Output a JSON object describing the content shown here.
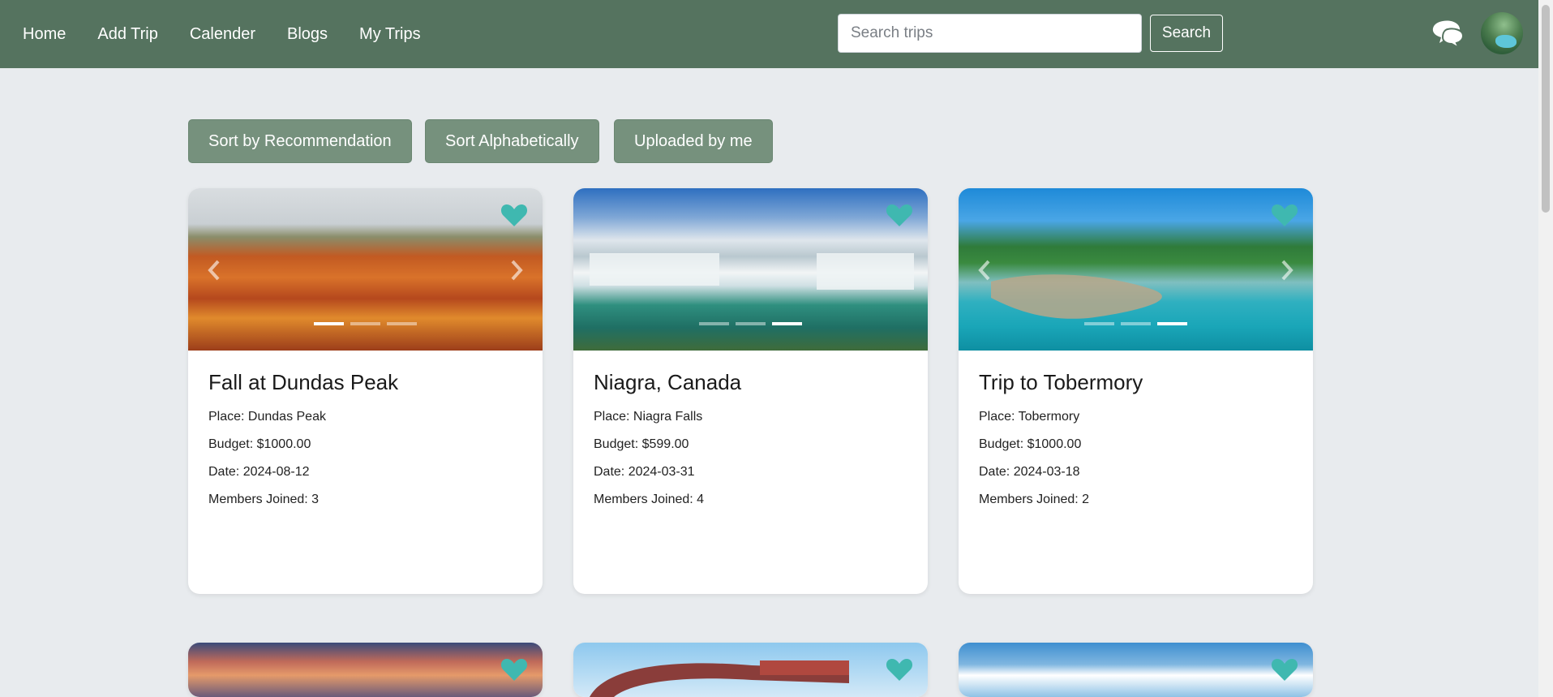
{
  "nav": {
    "links": [
      "Home",
      "Add Trip",
      "Calender",
      "Blogs",
      "My Trips"
    ],
    "search_placeholder": "Search trips",
    "search_button": "Search",
    "chat_icon": "chat-bubbles-icon",
    "avatar_icon": "user-avatar"
  },
  "sort": {
    "recommendation": "Sort by Recommendation",
    "alphabetical": "Sort Alphabetically",
    "uploaded": "Uploaded by me"
  },
  "colors": {
    "navbar": "#55735f",
    "sort_button": "#76917d",
    "heart": "#3fb8b0",
    "page_bg": "#e8ebee"
  },
  "trips": [
    {
      "title": "Fall at Dundas Peak",
      "place": "Place: Dundas Peak",
      "budget": "Budget: $1000.00",
      "date": "Date: 2024-08-12",
      "members": "Members Joined: 3",
      "active_slide": 1
    },
    {
      "title": "Niagra, Canada",
      "place": "Place: Niagra Falls",
      "budget": "Budget: $599.00",
      "date": "Date: 2024-03-31",
      "members": "Members Joined: 4",
      "active_slide": 3
    },
    {
      "title": "Trip to Tobermory",
      "place": "Place: Tobermory",
      "budget": "Budget: $1000.00",
      "date": "Date: 2024-03-18",
      "members": "Members Joined: 2",
      "active_slide": 3
    }
  ]
}
